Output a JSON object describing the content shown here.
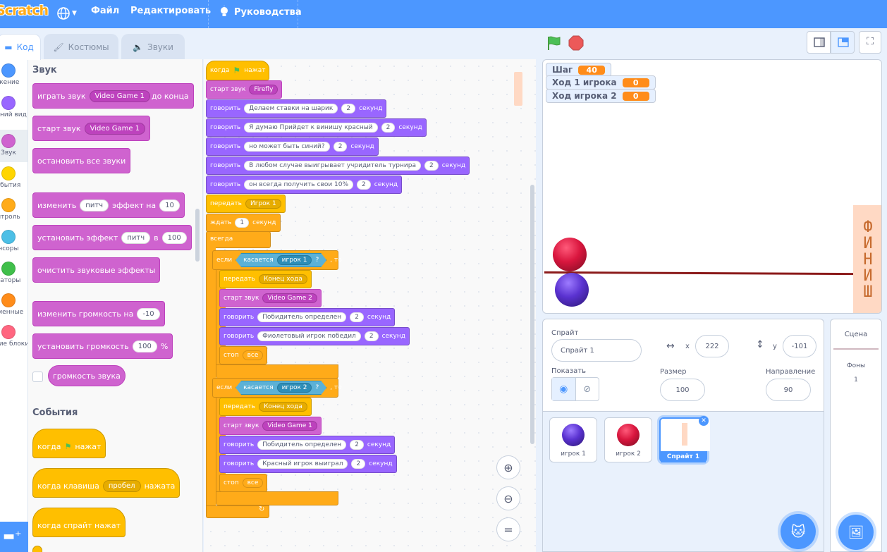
{
  "menubar": {
    "logo": "Scratch",
    "file": "Файл",
    "edit": "Редактировать",
    "tutorials": "Руководства"
  },
  "tabs": [
    {
      "label": "Код"
    },
    {
      "label": "Костюмы"
    },
    {
      "label": "Звуки"
    }
  ],
  "categories": [
    {
      "label": "жение",
      "color": "#4c97ff"
    },
    {
      "label": "ешний вид",
      "color": "#9966ff"
    },
    {
      "label": "Звук",
      "color": "#cf63cf"
    },
    {
      "label": "обытия",
      "color": "#ffd500"
    },
    {
      "label": "нтроль",
      "color": "#ffab19"
    },
    {
      "label": "нсоры",
      "color": "#4cbfe6"
    },
    {
      "label": "раторы",
      "color": "#40bf4a"
    },
    {
      "label": "еменные",
      "color": "#ff8c1a"
    },
    {
      "label": "ругие блоки",
      "color": "#ff6680"
    }
  ],
  "palette": {
    "sound_heading": "Звук",
    "play_until_done": {
      "a": "играть звук",
      "v": "Video Game 1",
      "b": "до конца"
    },
    "start_sound": {
      "a": "старт звук",
      "v": "Video Game 1"
    },
    "stop_all_sounds": "остановить все звуки",
    "change_effect": {
      "a": "изменить",
      "v": "питч",
      "b": "эффект на",
      "n": "10"
    },
    "set_effect": {
      "a": "установить эффект",
      "v": "питч",
      "b": "в",
      "n": "100"
    },
    "clear_effects": "очистить звуковые эффекты",
    "change_volume": {
      "a": "изменить громкость на",
      "n": "-10"
    },
    "set_volume": {
      "a": "установить громкость",
      "n": "100",
      "b": "%"
    },
    "volume": "громкость звука",
    "events_heading": "События",
    "when_flag": {
      "a": "когда",
      "b": "нажат"
    },
    "when_key": {
      "a": "когда клавиша",
      "v": "пробел",
      "b": "нажата"
    },
    "when_sprite": "когда спрайт нажат"
  },
  "script": {
    "when_flag": {
      "a": "когда",
      "b": "нажат"
    },
    "start_firefly": {
      "a": "старт звук",
      "v": "Firefly"
    },
    "says": [
      {
        "a": "говорить",
        "t": "Делаем ставки на шарик",
        "n": "2",
        "b": "секунд"
      },
      {
        "a": "говорить",
        "t": "Я думаю Прийдет к винишу красный",
        "n": "2",
        "b": "секунд"
      },
      {
        "a": "говорить",
        "t": "но может быть синий?",
        "n": "2",
        "b": "секунд"
      },
      {
        "a": "говорить",
        "t": "В любом случае выигрывает учридитель турнира",
        "n": "2",
        "b": "секунд"
      },
      {
        "a": "говорить",
        "t": "он всегда получить свои 10%",
        "n": "2",
        "b": "секунд"
      }
    ],
    "broadcast1": {
      "a": "передать",
      "v": "Игрок 1"
    },
    "wait": {
      "a": "ждать",
      "n": "1",
      "b": "секунд"
    },
    "forever": "всегда",
    "if1": {
      "a": "если",
      "c": "касается",
      "v": "игрок 1",
      "q": "?",
      "b": ", то"
    },
    "if1_body": {
      "bc": {
        "a": "передать",
        "v": "Конец хода"
      },
      "snd": {
        "a": "старт звук",
        "v": "Video Game 2"
      },
      "s1": {
        "a": "говорить",
        "t": "Побидитель определен",
        "n": "2",
        "b": "секунд"
      },
      "s2": {
        "a": "говорить",
        "t": "Фиолетовый игрок победил",
        "n": "2",
        "b": "секунд"
      },
      "stop": {
        "a": "стоп",
        "v": "все"
      }
    },
    "if2": {
      "a": "если",
      "c": "касается",
      "v": "игрок 2",
      "q": "?",
      "b": ", то"
    },
    "if2_body": {
      "bc": {
        "a": "передать",
        "v": "Конец хода"
      },
      "snd": {
        "a": "старт звук",
        "v": "Video Game 1"
      },
      "s1": {
        "a": "говорить",
        "t": "Побидитель определен",
        "n": "2",
        "b": "секунд"
      },
      "s2": {
        "a": "говорить",
        "t": "Красный игрок выиграл",
        "n": "2",
        "b": "секунд"
      },
      "stop": {
        "a": "стоп",
        "v": "все"
      }
    }
  },
  "zoom": {
    "reset": "="
  },
  "monitors": [
    {
      "label": "Шаг",
      "value": "40"
    },
    {
      "label": "Ход 1 игрока",
      "value": "0"
    },
    {
      "label": "Ход игрока 2",
      "value": "0"
    }
  ],
  "stage": {
    "finish": "ФИНИШ"
  },
  "sprite_info": {
    "sprite_label": "Спрайт",
    "name": "Спрайт 1",
    "x_label": "x",
    "x": "222",
    "y_label": "y",
    "y": "-101",
    "show_label": "Показать",
    "size_label": "Размер",
    "size": "100",
    "direction_label": "Направление",
    "direction": "90"
  },
  "sprites": [
    {
      "name": "игрок 1",
      "color": "#6a3fd8"
    },
    {
      "name": "игрок 2",
      "color": "#d9163e"
    },
    {
      "name": "Спрайт 1",
      "color": "#ffd9c4"
    }
  ],
  "scene": {
    "title": "Сцена",
    "backdrops_label": "Фоны",
    "backdrops_count": "1"
  }
}
